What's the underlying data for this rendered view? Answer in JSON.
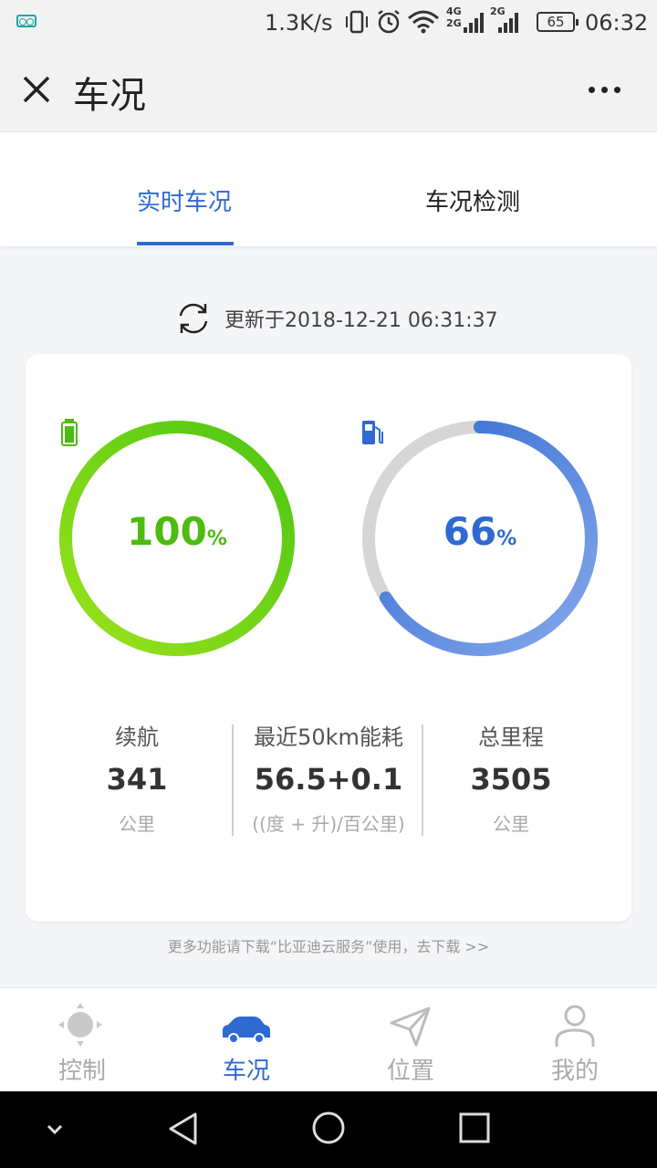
{
  "status_bar": {
    "speed": "1.3K/s",
    "battery": "65",
    "time": "06:32",
    "network_labels": [
      "4G",
      "2G",
      "2G"
    ]
  },
  "header": {
    "title": "车况"
  },
  "tabs": [
    {
      "label": "实时车况",
      "active": true
    },
    {
      "label": "车况检测",
      "active": false
    }
  ],
  "update": {
    "text": "更新于2018-12-21 06:31:37"
  },
  "gauges": {
    "battery": {
      "value": "100",
      "unit": "%",
      "level": 1.0,
      "color_start": "#9be31a",
      "color_end": "#4cc514"
    },
    "fuel": {
      "value": "66",
      "unit": "%",
      "level": 0.66,
      "color_start": "#86a8ec",
      "color_end": "#2e6ad1",
      "track_color": "#d6d6d6"
    }
  },
  "stats": {
    "range": {
      "label": "续航",
      "value": "341",
      "unit": "公里"
    },
    "energy": {
      "label": "最近50km能耗",
      "value": "56.5+0.1",
      "unit": "((度 + 升)/百公里)"
    },
    "total": {
      "label": "总里程",
      "value": "3505",
      "unit": "公里"
    }
  },
  "download_note": "更多功能请下载“比亚迪云服务”使用，去下载 >>",
  "bottom_nav": [
    {
      "label": "控制",
      "icon": "joystick-icon",
      "active": false
    },
    {
      "label": "车况",
      "icon": "car-icon",
      "active": true
    },
    {
      "label": "位置",
      "icon": "location-arrow-icon",
      "active": false
    },
    {
      "label": "我的",
      "icon": "person-icon",
      "active": false
    }
  ],
  "colors": {
    "accent": "#2e6ad1",
    "battery_green": "#4dbb10"
  }
}
